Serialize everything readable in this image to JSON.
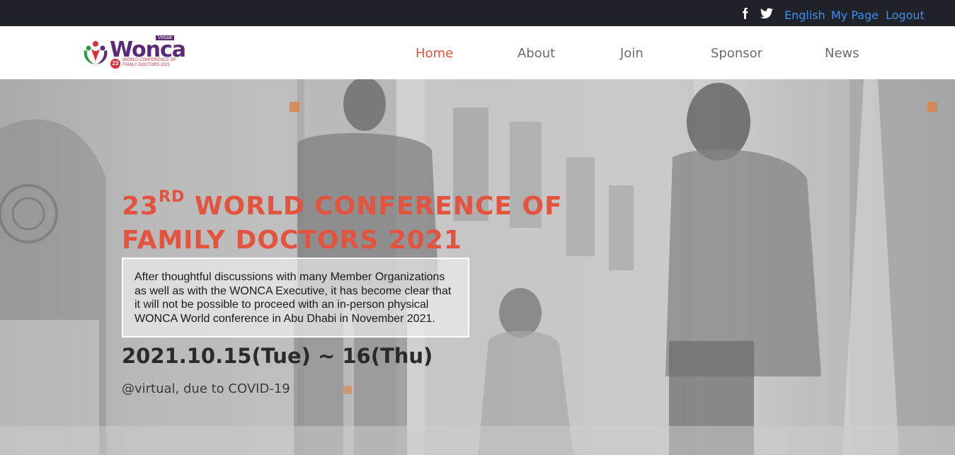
{
  "topbar": {
    "social": [
      "facebook-icon",
      "twitter-icon"
    ],
    "language": "English",
    "my_page": "My Page",
    "logout": "Logout"
  },
  "logo": {
    "name": "Wonca",
    "tag": "Virtual",
    "badge": "23",
    "subtitle": "WORLD CONFERENCE OF FAMILY DOCTORS 2021"
  },
  "nav": {
    "home": "Home",
    "about": "About",
    "join": "Join",
    "sponsor": "Sponsor",
    "news": "News",
    "active": "Home"
  },
  "hero": {
    "title_num": "23",
    "title_sup": "RD",
    "title_line1": " WORLD CONFERENCE OF",
    "title_line2": "FAMILY DOCTORS 2021",
    "notice": "After thoughtful discussions with many Member Organizations as well as with the WONCA Executive, it has become clear that it will not be possible to proceed with an in-person physical WONCA World conference in Abu Dhabi in November 2021.",
    "dates": "2021.10.15(Tue) ~ 16(Thu)",
    "venue": "@virtual, due to COVID-19"
  },
  "colors": {
    "accent": "#e3533e",
    "topbar_bg": "#1f2329",
    "link": "#3d8ef0",
    "brand_purple": "#5a2a74"
  }
}
